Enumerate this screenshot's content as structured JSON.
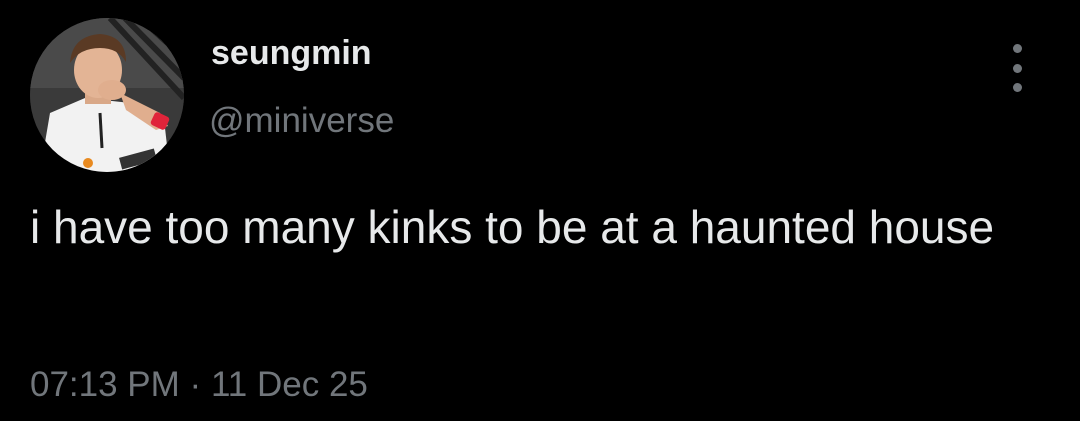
{
  "tweet": {
    "display_name": "seungmin",
    "handle": "@miniverse",
    "text": "i have too many kinks to be at a haunted house",
    "time": "07:13 PM",
    "separator": "·",
    "date": "11 Dec 25"
  },
  "icons": {
    "more": "more-vertical-icon"
  },
  "colors": {
    "background": "#000000",
    "primary_text": "#e7e9ea",
    "secondary_text": "#71767b"
  }
}
